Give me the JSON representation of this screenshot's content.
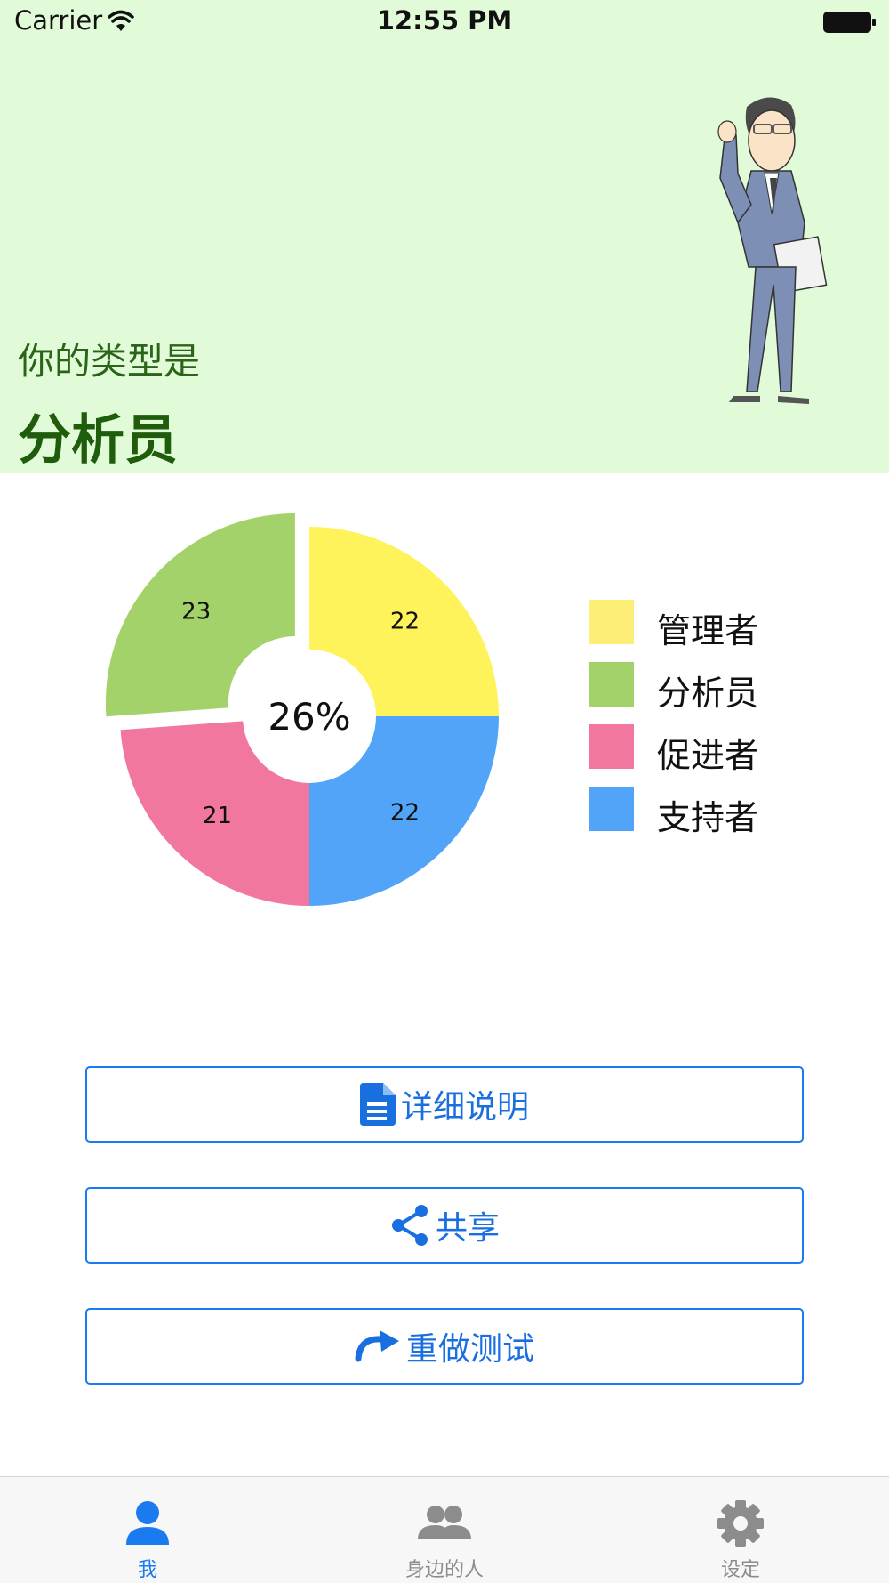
{
  "status_bar": {
    "carrier": "Carrier",
    "time": "12:55 PM"
  },
  "header": {
    "type_label": "你的类型是",
    "type_value": "分析员"
  },
  "chart_data": {
    "type": "pie",
    "center_label": "26%",
    "categories": [
      "管理者",
      "分析员",
      "促进者",
      "支持者"
    ],
    "values": [
      22,
      23,
      21,
      22
    ],
    "colors": [
      "#fef35a",
      "#a3d16a",
      "#f1779f",
      "#51a4f7"
    ],
    "legend_colors": [
      "#fdee78",
      "#a3d16a",
      "#f1779f",
      "#51a4f7"
    ],
    "highlighted": "分析员",
    "legend_position": "right"
  },
  "actions": {
    "detail_label": "详细说明",
    "share_label": "共享",
    "redo_label": "重做测试"
  },
  "tab_bar": {
    "items": [
      {
        "label": "我",
        "icon": "person-icon",
        "active": true
      },
      {
        "label": "身边的人",
        "icon": "people-icon",
        "active": false
      },
      {
        "label": "设定",
        "icon": "gear-icon",
        "active": false
      }
    ],
    "active_color": "#1a7af0",
    "inactive_color": "#8c8c8c"
  }
}
